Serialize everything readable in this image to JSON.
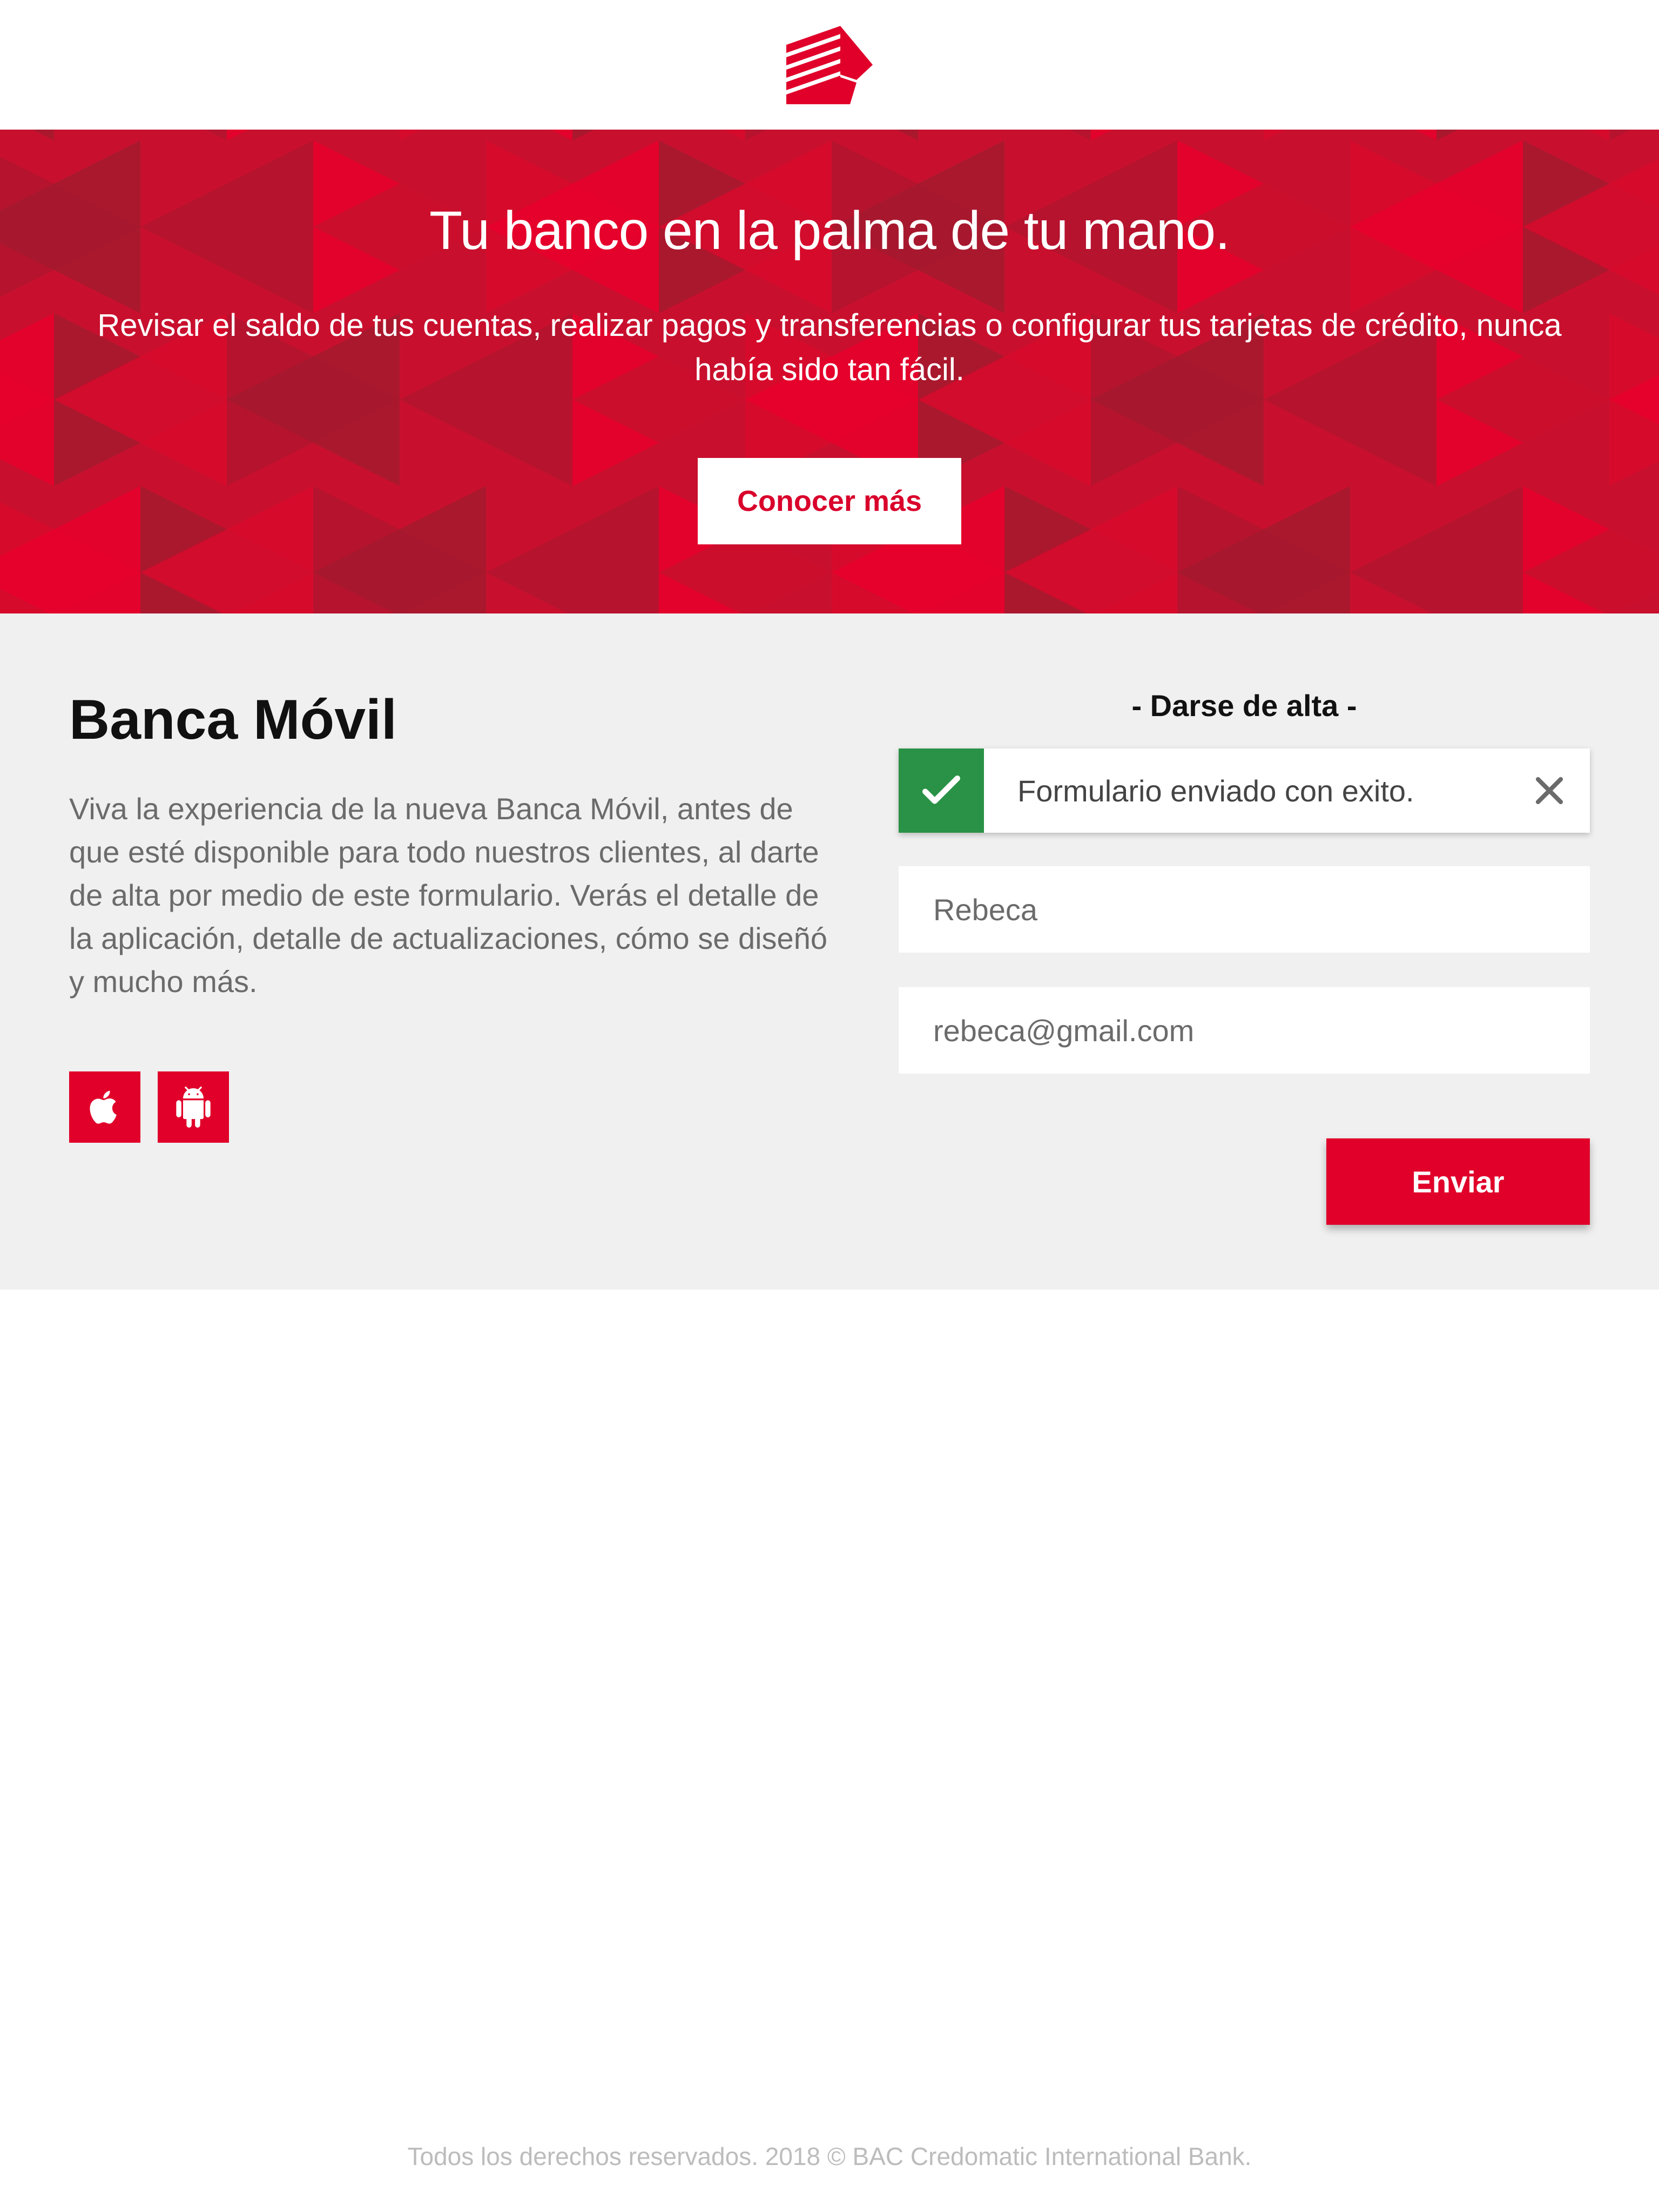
{
  "header": {
    "logo_icon": "bac-credomatic-logo"
  },
  "hero": {
    "title": "Tu banco en la palma de tu mano.",
    "description": "Revisar el saldo de tus cuentas, realizar pagos y transferencias o configurar tus tarjetas de crédito, nunca había sido tan fácil.",
    "button_label": "Conocer más"
  },
  "info": {
    "title": "Banca Móvil",
    "description": "Viva la experiencia de la nueva Banca Móvil, antes de que esté disponible para todo nuestros clientes, al darte de alta por medio de este formulario. Verás el detalle de la aplicación, detalle de actualizaciones, cómo se diseñó y mucho más.",
    "stores": [
      {
        "name": "apple",
        "icon": "apple-icon"
      },
      {
        "name": "android",
        "icon": "android-icon"
      }
    ]
  },
  "form": {
    "title": "- Darse de alta -",
    "alert": {
      "message": "Formulario enviado con exito.",
      "status_color": "#2a9246",
      "icon": "check-icon",
      "close_icon": "close-icon"
    },
    "name_value": "Rebeca",
    "email_value": "rebeca@gmail.com",
    "submit_label": "Enviar"
  },
  "footer": {
    "text": "Todos los derechos reservados. 2018 © BAC Credomatic International Bank."
  },
  "colors": {
    "brand_red": "#e0002a",
    "hero_red": "#c8102e",
    "success_green": "#2a9246",
    "section_gray": "#f0f0f0"
  }
}
